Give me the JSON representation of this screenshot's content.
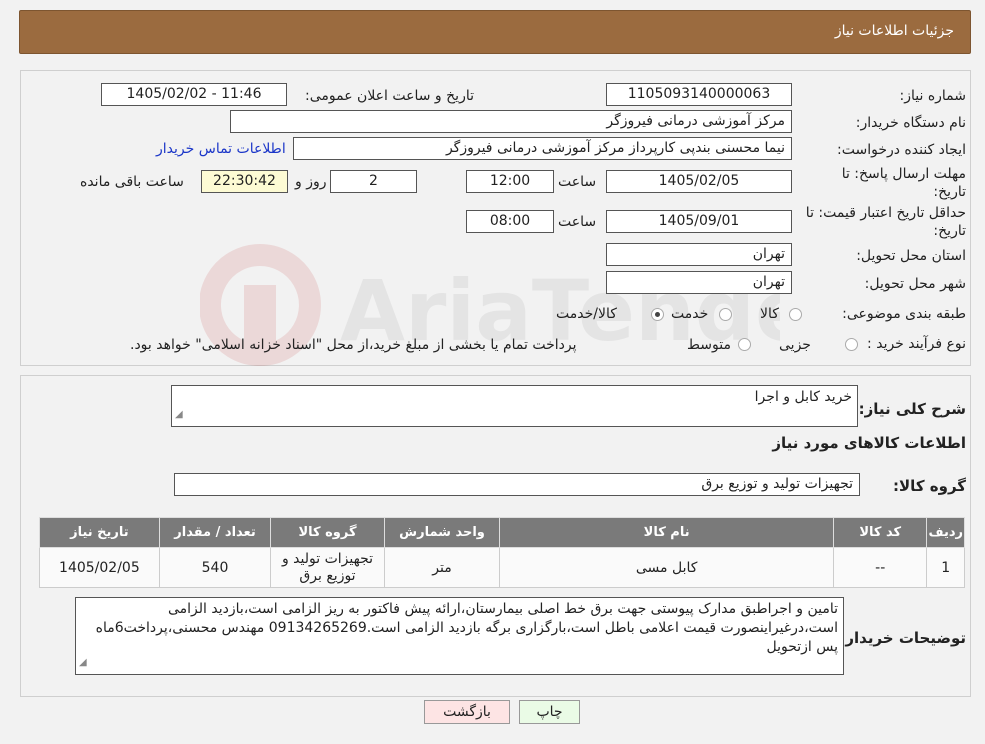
{
  "header": {
    "title": "جزئیات اطلاعات نیاز"
  },
  "fields": {
    "need_number_label": "شماره نیاز:",
    "need_number": "1105093140000063",
    "announce_label": "تاریخ و ساعت اعلان عمومی:",
    "announce_value": "1405/02/02 - 11:46",
    "buyer_org_label": "نام دستگاه خریدار:",
    "buyer_org": "مرکز آموزشی درمانی فیروزگر",
    "creator_label": "ایجاد کننده درخواست:",
    "creator": "نیما محسنی بندپی کارپرداز مرکز آموزشی درمانی فیروزگر",
    "contact_link": "اطلاعات تماس خریدار",
    "deadline_label_1": "مهلت ارسال پاسخ: تا",
    "deadline_label_2": "تاریخ:",
    "deadline_date": "1405/02/05",
    "time_label": "ساعت",
    "deadline_time": "12:00",
    "days_value": "2",
    "days_label": "روز و",
    "remaining_time": "22:30:42",
    "remaining_label": "ساعت باقی مانده",
    "price_valid_label_1": "حداقل تاریخ اعتبار قیمت: تا",
    "price_valid_label_2": "تاریخ:",
    "price_valid_date": "1405/09/01",
    "price_valid_time": "08:00",
    "province_label": "استان محل تحویل:",
    "province": "تهران",
    "city_label": "شهر محل تحویل:",
    "city": "تهران",
    "category_label": "طبقه بندی موضوعی:",
    "category_options": [
      "کالا",
      "خدمت",
      "کالا/خدمت"
    ],
    "process_label": "نوع فرآیند خرید :",
    "process_options": [
      "جزیی",
      "متوسط"
    ],
    "process_note": "پرداخت تمام یا بخشی از مبلغ خرید،از محل \"اسناد خزانه اسلامی\" خواهد بود."
  },
  "summary": {
    "label": "شرح کلی نیاز:",
    "value": "خرید کابل و اجرا",
    "items_title": "اطلاعات کالاهای مورد نیاز",
    "group_label": "گروه کالا:",
    "group_value": "تجهیزات تولید و توزیع برق"
  },
  "table": {
    "headers": [
      "ردیف",
      "کد کالا",
      "نام کالا",
      "واحد شمارش",
      "گروه کالا",
      "تعداد / مقدار",
      "تاریخ نیاز"
    ],
    "rows": [
      {
        "row": "1",
        "code": "--",
        "name": "کابل مسی",
        "unit": "متر",
        "group": "تجهیزات تولید و توزیع برق",
        "qty": "540",
        "date": "1405/02/05"
      }
    ]
  },
  "buyer_notes": {
    "label": "توضیحات خریدار:",
    "text": "تامین و اجراطبق مدارک پیوستی جهت برق خط اصلی بیمارستان،ارائه پیش فاکتور به ریز الزامی است،بازدید الزامی است،درغیراینصورت قیمت اعلامی باطل است،بارگزاری برگه بازدید الزامی است.09134265269 مهندس محسنی،پرداخت6ماه پس ازتحویل"
  },
  "buttons": {
    "print": "چاپ",
    "back": "بازگشت"
  },
  "colors": {
    "header_bg": "#9b6b3f",
    "table_header": "#7a7a7a",
    "link": "#1b36c8"
  },
  "watermark": "AriaTender.neT"
}
